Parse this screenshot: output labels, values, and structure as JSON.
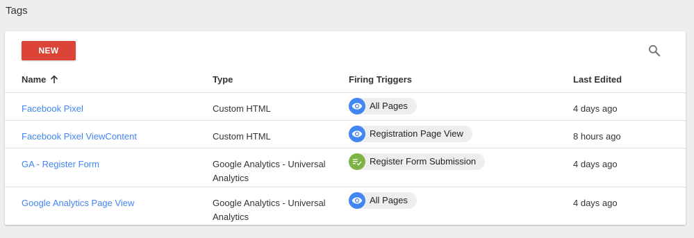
{
  "page": {
    "title": "Tags"
  },
  "toolbar": {
    "new_label": "NEW",
    "search_icon": "search-icon"
  },
  "colors": {
    "accent_red": "#db4437",
    "link_blue": "#4285f4",
    "trigger_green": "#7cb342",
    "chip_bg": "#eeeeee"
  },
  "table": {
    "headers": {
      "name": "Name",
      "name_sort_icon": "arrow-up-icon",
      "type": "Type",
      "triggers": "Firing Triggers",
      "last_edited": "Last Edited"
    },
    "rows": [
      {
        "name": "Facebook Pixel",
        "type": "Custom HTML",
        "trigger": {
          "label": "All Pages",
          "icon": "eye-icon",
          "color": "#4285f4"
        },
        "last_edited": "4 days ago"
      },
      {
        "name": "Facebook Pixel ViewContent",
        "type": "Custom HTML",
        "trigger": {
          "label": "Registration Page View",
          "icon": "eye-icon",
          "color": "#4285f4"
        },
        "last_edited": "8 hours ago"
      },
      {
        "name": "GA - Register Form",
        "type": "Google Analytics - Universal Analytics",
        "trigger": {
          "label": "Register Form Submission",
          "icon": "form-submit-icon",
          "color": "#7cb342"
        },
        "last_edited": "4 days ago"
      },
      {
        "name": "Google Analytics Page View",
        "type": "Google Analytics - Universal Analytics",
        "trigger": {
          "label": "All Pages",
          "icon": "eye-icon",
          "color": "#4285f4"
        },
        "last_edited": "4 days ago"
      }
    ]
  }
}
